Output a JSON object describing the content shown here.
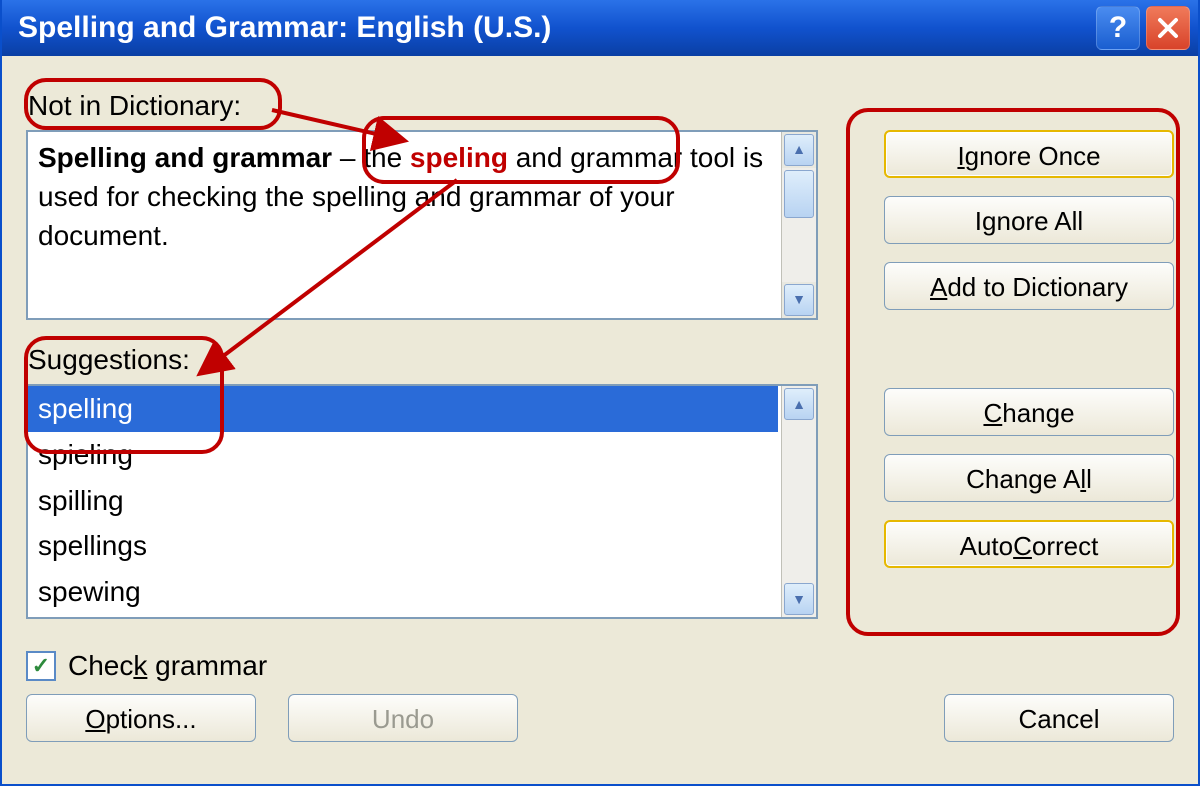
{
  "window": {
    "title": "Spelling and Grammar: English (U.S.)"
  },
  "labels": {
    "not_in_dictionary": "Not in Dictionary:",
    "suggestions": "Suggestions:",
    "check_grammar": "Check grammar"
  },
  "sentence": {
    "bold_prefix": "Spelling and grammar",
    "dash": " – ",
    "before_error": "the ",
    "error_word": "speling",
    "after_error": " and grammar tool is used for checking the spelling and grammar of your document."
  },
  "suggestions": [
    "spelling",
    "spieling",
    "spilling",
    "spellings",
    "spewing"
  ],
  "selected_suggestion_index": 0,
  "buttons": {
    "ignore_once": "Ignore Once",
    "ignore_all": "Ignore All",
    "add_to_dictionary": "Add to Dictionary",
    "change": "Change",
    "change_all": "Change All",
    "autocorrect": "AutoCorrect",
    "options": "Options...",
    "undo": "Undo",
    "cancel": "Cancel"
  },
  "check_grammar_checked": true,
  "colors": {
    "titlebar_blue": "#1152CE",
    "dialog_bg": "#ECE9D8",
    "error_red": "#C00000",
    "selection_blue": "#2A6BD8",
    "annotation_red": "#C00000"
  }
}
